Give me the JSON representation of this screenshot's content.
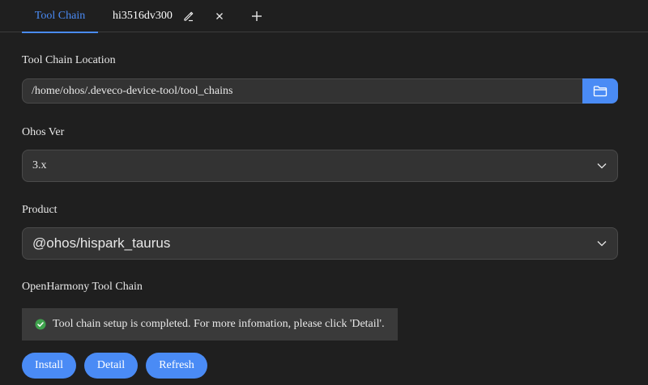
{
  "tabs": {
    "active_label": "Tool Chain",
    "device_label": "hi3516dv300"
  },
  "location": {
    "label": "Tool Chain Location",
    "value": "/home/ohos/.deveco-device-tool/tool_chains"
  },
  "ohos": {
    "label": "Ohos Ver",
    "selected": "3.x"
  },
  "product": {
    "label": "Product",
    "selected": "@ohos/hispark_taurus"
  },
  "toolchain": {
    "label": "OpenHarmony Tool Chain",
    "status": "Tool chain setup is completed. For more infomation, please click 'Detail'."
  },
  "buttons": {
    "install": "Install",
    "detail": "Detail",
    "refresh": "Refresh"
  },
  "colors": {
    "accent": "#4a8bf5",
    "background": "#1f1f1f",
    "field": "#333333",
    "success": "#3fa34d"
  },
  "icons": {
    "edit": "pencil-icon",
    "close": "close-icon",
    "add": "plus-icon",
    "folder": "folder-icon",
    "dropdown": "chevron-down-icon",
    "status": "check-circle-icon"
  }
}
